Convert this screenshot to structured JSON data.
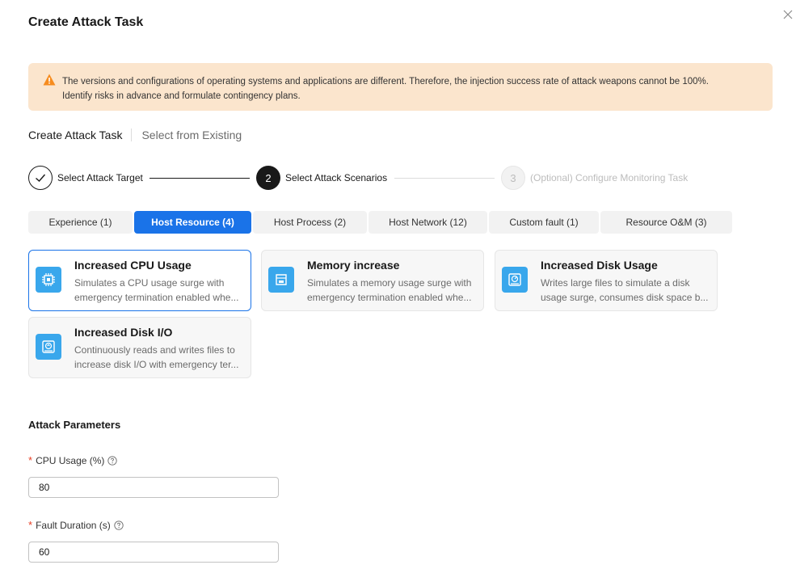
{
  "dialog": {
    "title": "Create Attack Task"
  },
  "alert": {
    "line1": "The versions and configurations of operating systems and applications are different. Therefore, the injection success rate of attack weapons cannot be 100%.",
    "line2": "Identify risks in advance and formulate contingency plans."
  },
  "mode_switch": {
    "items": [
      "Create Attack Task",
      "Select from Existing"
    ]
  },
  "steps": [
    {
      "label": "Select Attack Target",
      "status": "done",
      "icon": "check-icon"
    },
    {
      "number": "2",
      "label": "Select Attack Scenarios",
      "status": "current"
    },
    {
      "number": "3",
      "label": "(Optional) Configure Monitoring Task",
      "status": "pending"
    }
  ],
  "tabs": [
    {
      "label": "Experience (1)"
    },
    {
      "label": "Host Resource (4)"
    },
    {
      "label": "Host Process (2)"
    },
    {
      "label": "Host Network (12)"
    },
    {
      "label": "Custom fault (1)"
    },
    {
      "label": "Resource O&M  (3)"
    }
  ],
  "active_tab": "Host Resource (4)",
  "scenarios": [
    {
      "title": "Increased CPU Usage",
      "desc_line1": "Simulates a CPU usage surge with",
      "desc_line2": "emergency termination enabled whe...",
      "icon": "cpu-icon",
      "selected": true
    },
    {
      "title": "Memory increase",
      "desc_line1": "Simulates a memory usage surge with",
      "desc_line2": "emergency termination enabled whe...",
      "icon": "memory-icon",
      "selected": false
    },
    {
      "title": "Increased Disk Usage",
      "desc_line1": "Writes large files to simulate a disk",
      "desc_line2": "usage surge, consumes disk space b...",
      "icon": "disk-icon",
      "selected": false
    },
    {
      "title": "Increased Disk I/O",
      "desc_line1": "Continuously reads and writes files to",
      "desc_line2": "increase disk I/O with emergency ter...",
      "icon": "disk-io-icon",
      "selected": false
    }
  ],
  "params": {
    "section_title": "Attack Parameters",
    "cpu_usage": {
      "label": "CPU Usage (%)",
      "value": "80"
    },
    "fault_duration": {
      "label": "Fault Duration (s)",
      "value": "60"
    }
  },
  "colors": {
    "primary": "#1a73e8",
    "warning_bg": "#fbe5cd",
    "warning_icon": "#f68c1f",
    "required": "#e84026",
    "icon_bg": "#39a7ec"
  }
}
